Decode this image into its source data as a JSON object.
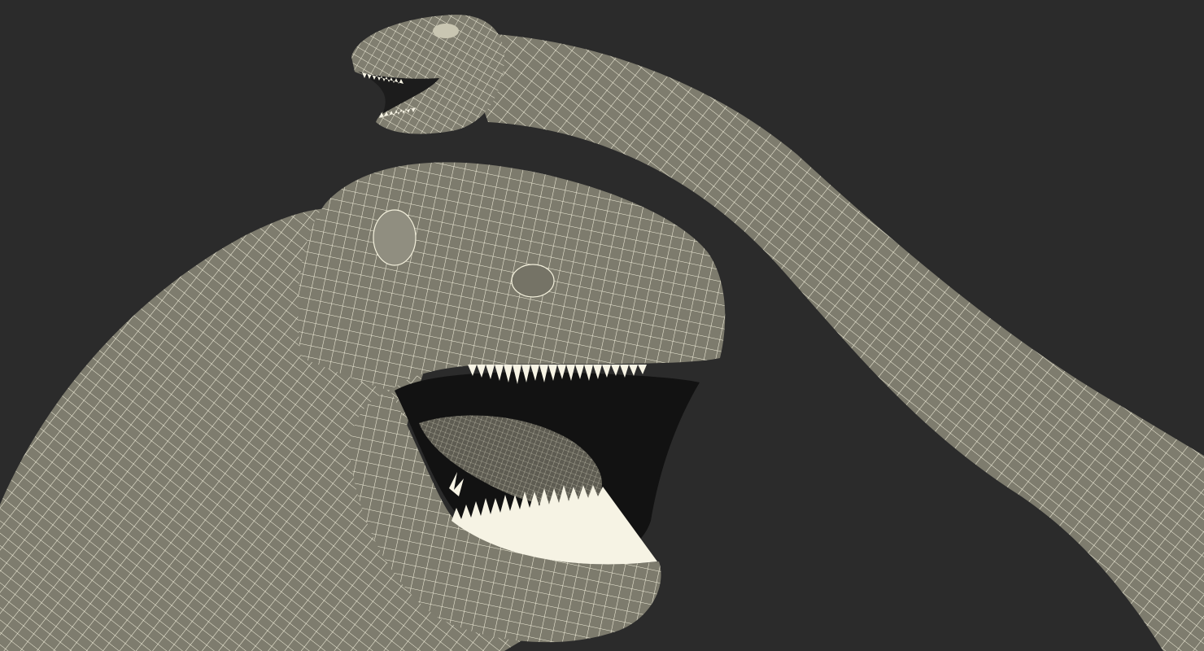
{
  "scene": {
    "background": "#2b2b2b",
    "mesh_fill": "#7d7b6d",
    "mesh_fill_light": "#8a887a",
    "wire_color": "#f3f0dc",
    "mouth_dark": "#111111",
    "tongue_color": "#5e5c52",
    "teeth_color": "#f6f3e4",
    "subjects": [
      "large-dinosaur-head-wireframe",
      "small-dinosaur-head-wireframe"
    ]
  }
}
